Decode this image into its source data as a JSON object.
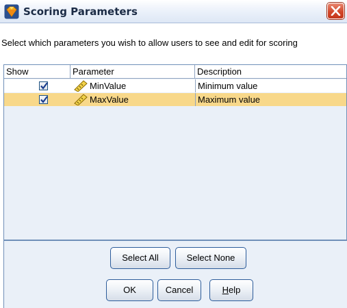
{
  "window": {
    "title": "Scoring Parameters"
  },
  "instructions": "Select which parameters you wish to allow users to see and edit for scoring",
  "table": {
    "columns": [
      "Show",
      "Parameter",
      "Description"
    ],
    "rows": [
      {
        "show": true,
        "parameter": "MinValue",
        "description": "Minimum value",
        "selected": false,
        "icon": "ruler-icon"
      },
      {
        "show": true,
        "parameter": "MaxValue",
        "description": "Maximum value",
        "selected": true,
        "icon": "ruler-icon"
      }
    ]
  },
  "buttons": {
    "select_all": "Select All",
    "select_none": "Select None",
    "ok": "OK",
    "cancel": "Cancel",
    "help_underlined": "H",
    "help_rest": "elp"
  },
  "colors": {
    "selected_row": "#f8d88a",
    "panel_bg": "#eaf0f8",
    "close_button": "#d2472a"
  }
}
